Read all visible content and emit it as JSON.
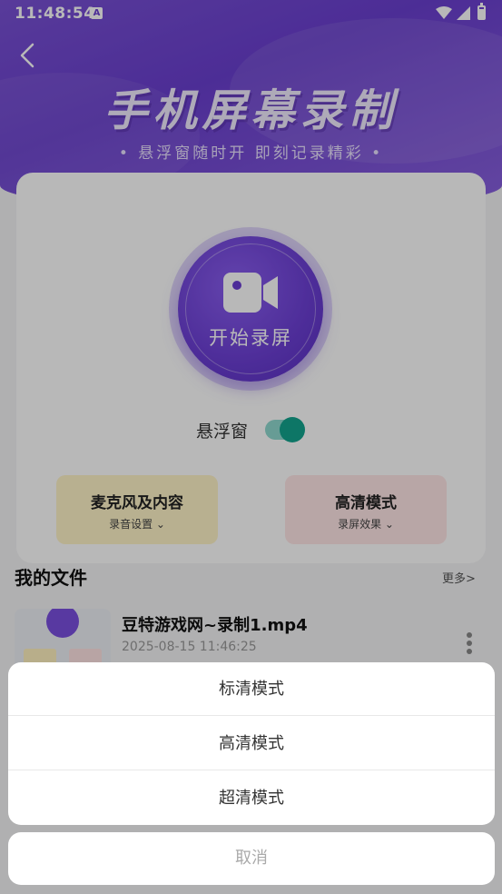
{
  "status_bar": {
    "time": "11:48:54",
    "notification_icon": "A"
  },
  "header": {
    "back_icon": "chevron-left-icon",
    "title": "手机屏幕录制",
    "subtitle": "• 悬浮窗随时开  即刻记录精彩 •"
  },
  "record": {
    "label": "开始录屏",
    "icon": "video-camera-icon"
  },
  "floating_window": {
    "label": "悬浮窗",
    "enabled": true
  },
  "modes": {
    "mic": {
      "title": "麦克风及内容",
      "sub": "录音设置 ⌄"
    },
    "hd": {
      "title": "高清模式",
      "sub": "录屏效果 ⌄"
    }
  },
  "files": {
    "title": "我的文件",
    "more": "更多>",
    "items": [
      {
        "name": "豆特游戏网~录制1.mp4",
        "date": "2025-08-15 11:46:25"
      }
    ]
  },
  "action_sheet": {
    "options": [
      "标清模式",
      "高清模式",
      "超清模式"
    ],
    "cancel": "取消"
  },
  "colors": {
    "accent": "#6b3ed4",
    "toggle": "#12a48e"
  }
}
